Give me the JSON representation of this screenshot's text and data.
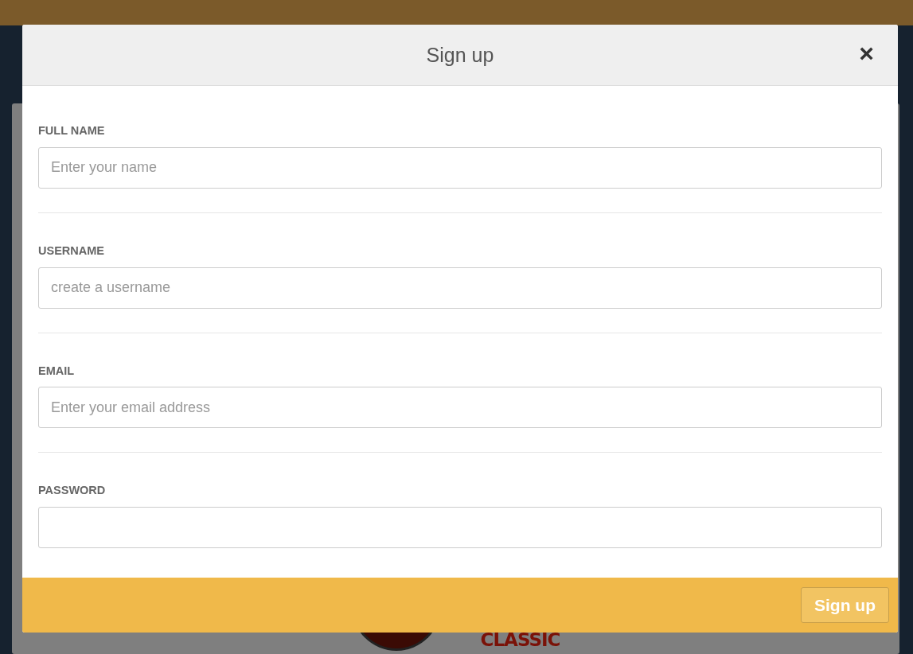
{
  "modal": {
    "title": "Sign up",
    "close": "×",
    "fields": [
      {
        "label": "FULL NAME",
        "placeholder": "Enter your name"
      },
      {
        "label": "USERNAME",
        "placeholder": "create a username"
      },
      {
        "label": "EMAIL",
        "placeholder": "Enter your email address"
      },
      {
        "label": "PASSWORD"
      }
    ],
    "submit": "Sign up"
  },
  "background": {
    "logo_text": "CLASSIC"
  }
}
